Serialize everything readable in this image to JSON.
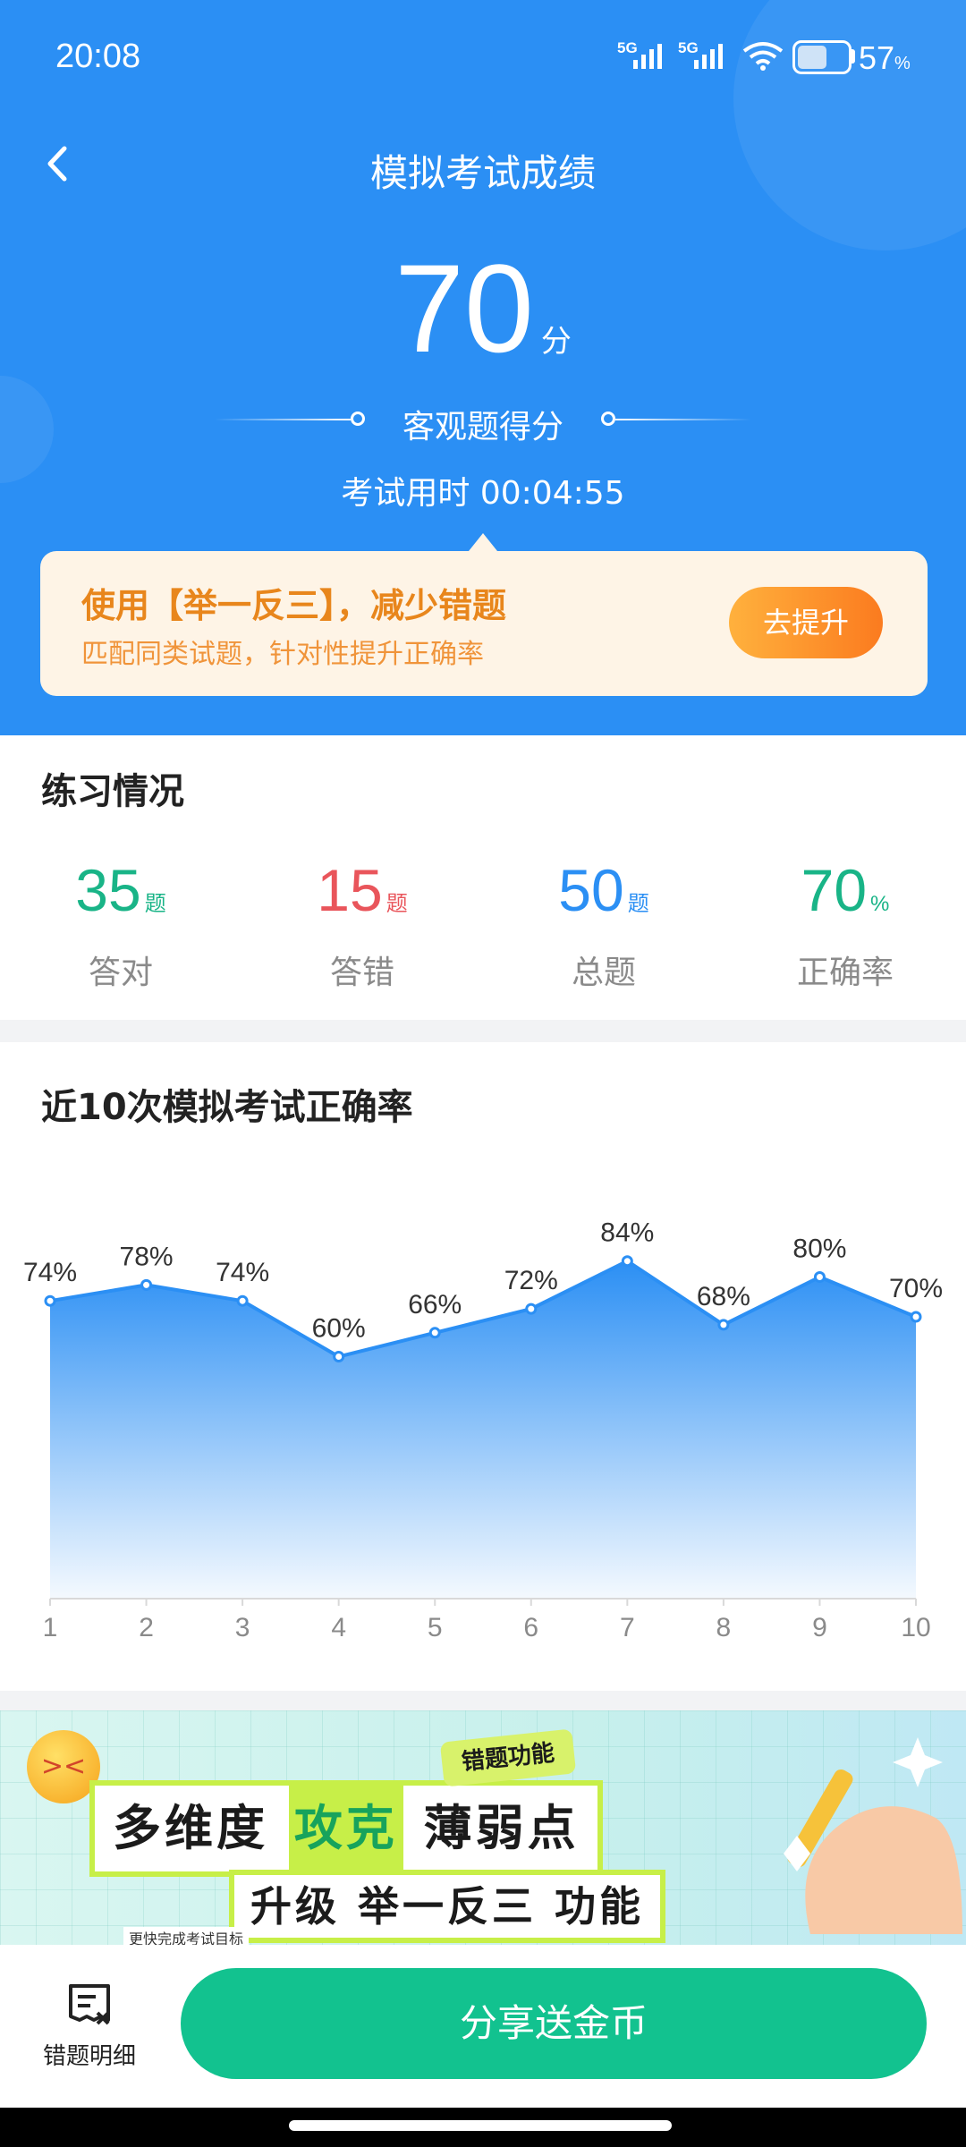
{
  "status_bar": {
    "time": "20:08",
    "net1": "5G",
    "net2": "5G",
    "battery": "57",
    "battery_unit": "%",
    "battery_level": 0.57
  },
  "header": {
    "title": "模拟考试成绩",
    "score": "70",
    "score_unit": "分",
    "score_label": "客观题得分",
    "duration": "考试用时 00:04:55"
  },
  "promo": {
    "title": "使用【举一反三】，减少错题",
    "subtitle": "匹配同类试题，针对性提升正确率",
    "button": "去提升"
  },
  "practice": {
    "title": "练习情况",
    "stats": [
      {
        "value": "35",
        "unit": "题",
        "label": "答对",
        "color": "#19b487"
      },
      {
        "value": "15",
        "unit": "题",
        "label": "答错",
        "color": "#e9555b"
      },
      {
        "value": "50",
        "unit": "题",
        "label": "总题",
        "color": "#2b8ff4"
      },
      {
        "value": "70",
        "unit": "%",
        "label": "正确率",
        "color": "#19b487"
      }
    ]
  },
  "chart_section": {
    "title": "近10次模拟考试正确率"
  },
  "chart_data": {
    "type": "area",
    "x": [
      1,
      2,
      3,
      4,
      5,
      6,
      7,
      8,
      9,
      10
    ],
    "values": [
      74,
      78,
      74,
      60,
      66,
      72,
      84,
      68,
      80,
      70
    ],
    "point_labels": [
      "74%",
      "78%",
      "74%",
      "60%",
      "66%",
      "72%",
      "84%",
      "68%",
      "80%",
      "70%"
    ],
    "title": "近10次模拟考试正确率",
    "xlabel": "",
    "ylabel": "",
    "grid": false,
    "color": "#2b8ff4"
  },
  "banner": {
    "tag": "错题功能",
    "line1_a": "多维度",
    "line1_hl": "攻克",
    "line1_b": "薄弱点",
    "line2": "升级 举一反三 功能",
    "note": "更快完成考试目标"
  },
  "bottom": {
    "errors_label": "错题明细",
    "share_button": "分享送金币"
  },
  "colors": {
    "primary": "#2b8ff4",
    "accent_orange": "#fb7b1f",
    "green": "#12c28f"
  }
}
